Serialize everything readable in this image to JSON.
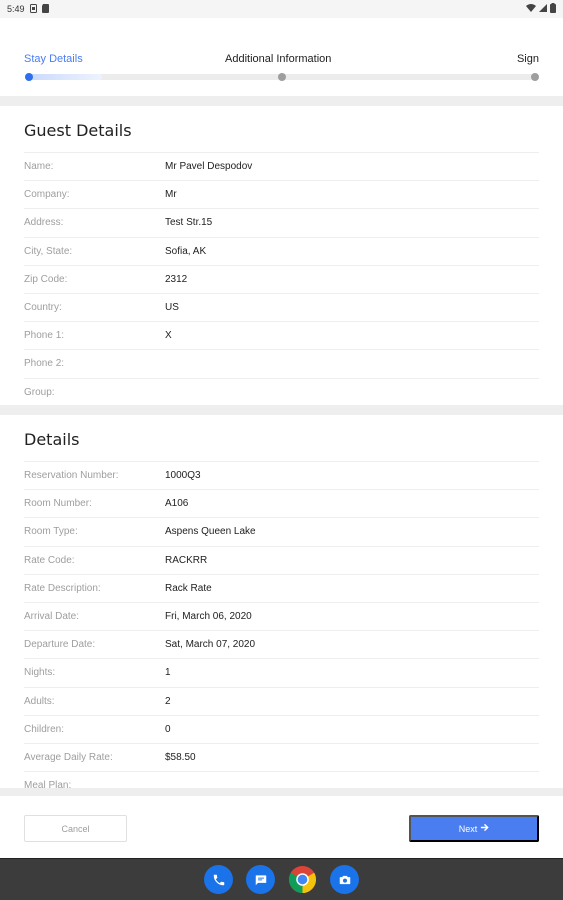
{
  "status_bar": {
    "time": "5:49"
  },
  "stepper": {
    "steps": [
      "Stay Details",
      "Additional Information",
      "Sign"
    ],
    "active_index": 0,
    "active_color": "#2f6fed"
  },
  "guest_details": {
    "title": "Guest Details",
    "rows": [
      {
        "label": "Name:",
        "value": "Mr Pavel Despodov"
      },
      {
        "label": "Company:",
        "value": "Mr"
      },
      {
        "label": "Address:",
        "value": "Test Str.15"
      },
      {
        "label": "City, State:",
        "value": "Sofia, AK"
      },
      {
        "label": "Zip Code:",
        "value": "2312"
      },
      {
        "label": "Country:",
        "value": "US"
      },
      {
        "label": "Phone 1:",
        "value": "X"
      },
      {
        "label": "Phone 2:",
        "value": ""
      },
      {
        "label": "Group:",
        "value": ""
      }
    ]
  },
  "details": {
    "title": "Details",
    "rows": [
      {
        "label": "Reservation Number:",
        "value": "1000Q3"
      },
      {
        "label": "Room Number:",
        "value": "A106"
      },
      {
        "label": "Room Type:",
        "value": "Aspens Queen Lake"
      },
      {
        "label": "Rate Code:",
        "value": "RACKRR"
      },
      {
        "label": "Rate Description:",
        "value": "Rack Rate"
      },
      {
        "label": "Arrival Date:",
        "value": "Fri, March 06, 2020"
      },
      {
        "label": "Departure Date:",
        "value": "Sat, March 07, 2020"
      },
      {
        "label": "Nights:",
        "value": "1"
      },
      {
        "label": "Adults:",
        "value": "2"
      },
      {
        "label": "Children:",
        "value": "0"
      },
      {
        "label": "Average Daily Rate:",
        "value": "$58.50"
      },
      {
        "label": "Meal Plan:",
        "value": ""
      }
    ]
  },
  "footer": {
    "cancel_label": "Cancel",
    "next_label": "Next",
    "accent": "#4a7df0"
  },
  "nav_bar": {
    "apps": [
      "phone-icon",
      "messages-icon",
      "chrome-icon",
      "camera-icon"
    ]
  }
}
